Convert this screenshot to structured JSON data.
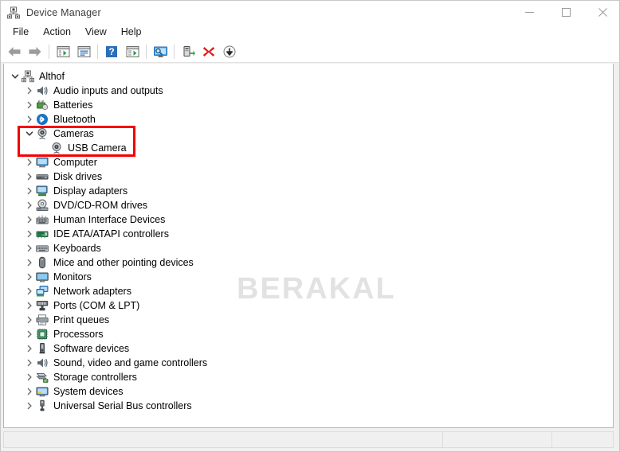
{
  "window": {
    "title": "Device Manager",
    "icon": "device-manager-icon",
    "controls": {
      "minimize": "─",
      "maximize": "□",
      "close": "✕"
    }
  },
  "menubar": {
    "items": [
      {
        "label": "File",
        "name": "menu-file"
      },
      {
        "label": "Action",
        "name": "menu-action"
      },
      {
        "label": "View",
        "name": "menu-view"
      },
      {
        "label": "Help",
        "name": "menu-help"
      }
    ]
  },
  "toolbar": {
    "buttons": [
      {
        "name": "back-button",
        "icon": "back-arrow-icon",
        "tooltip": "Back"
      },
      {
        "name": "forward-button",
        "icon": "forward-arrow-icon",
        "tooltip": "Forward"
      },
      {
        "name": "separator-1",
        "icon": "separator",
        "tooltip": ""
      },
      {
        "name": "show-hide-console-tree-button",
        "icon": "console-tree-icon",
        "tooltip": "Show/Hide Console Tree"
      },
      {
        "name": "properties-button",
        "icon": "properties-icon",
        "tooltip": "Properties"
      },
      {
        "name": "separator-2",
        "icon": "separator",
        "tooltip": ""
      },
      {
        "name": "help-button",
        "icon": "help-question-icon",
        "tooltip": "Help"
      },
      {
        "name": "show-hide-action-pane-button",
        "icon": "action-pane-icon",
        "tooltip": "Show/Hide Action Pane"
      },
      {
        "name": "separator-3",
        "icon": "separator",
        "tooltip": ""
      },
      {
        "name": "scan-for-hardware-changes-button",
        "icon": "monitor-scan-icon",
        "tooltip": "Scan for hardware changes"
      },
      {
        "name": "separator-4",
        "icon": "separator",
        "tooltip": ""
      },
      {
        "name": "update-driver-button",
        "icon": "update-driver-icon",
        "tooltip": "Update Driver Software"
      },
      {
        "name": "uninstall-device-button",
        "icon": "red-x-icon",
        "tooltip": "Uninstall device"
      },
      {
        "name": "disable-device-button",
        "icon": "down-arrow-circle-icon",
        "tooltip": "Disable device"
      }
    ]
  },
  "tree": {
    "nodes": [
      {
        "label": "Althof",
        "depth": 0,
        "expanded": true,
        "twisty": "chevron-down",
        "icon": "computer-root-icon",
        "name": "tree-node-althof"
      },
      {
        "label": "Audio inputs and outputs",
        "depth": 1,
        "expanded": false,
        "twisty": "chevron-right",
        "icon": "speaker-icon",
        "name": "tree-node-audio-inputs-and-outputs"
      },
      {
        "label": "Batteries",
        "depth": 1,
        "expanded": false,
        "twisty": "chevron-right",
        "icon": "battery-icon",
        "name": "tree-node-batteries"
      },
      {
        "label": "Bluetooth",
        "depth": 1,
        "expanded": false,
        "twisty": "chevron-right",
        "icon": "bluetooth-icon",
        "name": "tree-node-bluetooth"
      },
      {
        "label": "Cameras",
        "depth": 1,
        "expanded": true,
        "twisty": "chevron-down",
        "icon": "camera-icon",
        "name": "tree-node-cameras"
      },
      {
        "label": "USB Camera",
        "depth": 2,
        "expanded": false,
        "twisty": "none",
        "icon": "camera-icon",
        "name": "tree-node-usb-camera"
      },
      {
        "label": "Computer",
        "depth": 1,
        "expanded": false,
        "twisty": "chevron-right",
        "icon": "monitor-icon",
        "name": "tree-node-computer"
      },
      {
        "label": "Disk drives",
        "depth": 1,
        "expanded": false,
        "twisty": "chevron-right",
        "icon": "disk-drive-icon",
        "name": "tree-node-disk-drives"
      },
      {
        "label": "Display adapters",
        "depth": 1,
        "expanded": false,
        "twisty": "chevron-right",
        "icon": "display-adapter-icon",
        "name": "tree-node-display-adapters"
      },
      {
        "label": "DVD/CD-ROM drives",
        "depth": 1,
        "expanded": false,
        "twisty": "chevron-right",
        "icon": "optical-drive-icon",
        "name": "tree-node-dvd-cd-rom-drives"
      },
      {
        "label": "Human Interface Devices",
        "depth": 1,
        "expanded": false,
        "twisty": "chevron-right",
        "icon": "hid-icon",
        "name": "tree-node-human-interface-devices"
      },
      {
        "label": "IDE ATA/ATAPI controllers",
        "depth": 1,
        "expanded": false,
        "twisty": "chevron-right",
        "icon": "ide-controller-icon",
        "name": "tree-node-ide-ata-atapi-controllers"
      },
      {
        "label": "Keyboards",
        "depth": 1,
        "expanded": false,
        "twisty": "chevron-right",
        "icon": "keyboard-icon",
        "name": "tree-node-keyboards"
      },
      {
        "label": "Mice and other pointing devices",
        "depth": 1,
        "expanded": false,
        "twisty": "chevron-right",
        "icon": "mouse-icon",
        "name": "tree-node-mice-and-other-pointing-devices"
      },
      {
        "label": "Monitors",
        "depth": 1,
        "expanded": false,
        "twisty": "chevron-right",
        "icon": "monitor-blue-icon",
        "name": "tree-node-monitors"
      },
      {
        "label": "Network adapters",
        "depth": 1,
        "expanded": false,
        "twisty": "chevron-right",
        "icon": "network-adapter-icon",
        "name": "tree-node-network-adapters"
      },
      {
        "label": "Ports (COM & LPT)",
        "depth": 1,
        "expanded": false,
        "twisty": "chevron-right",
        "icon": "port-icon",
        "name": "tree-node-ports-com-lpt"
      },
      {
        "label": "Print queues",
        "depth": 1,
        "expanded": false,
        "twisty": "chevron-right",
        "icon": "printer-icon",
        "name": "tree-node-print-queues"
      },
      {
        "label": "Processors",
        "depth": 1,
        "expanded": false,
        "twisty": "chevron-right",
        "icon": "processor-icon",
        "name": "tree-node-processors"
      },
      {
        "label": "Software devices",
        "depth": 1,
        "expanded": false,
        "twisty": "chevron-right",
        "icon": "software-device-icon",
        "name": "tree-node-software-devices"
      },
      {
        "label": "Sound, video and game controllers",
        "depth": 1,
        "expanded": false,
        "twisty": "chevron-right",
        "icon": "speaker-icon",
        "name": "tree-node-sound-video-and-game-controllers"
      },
      {
        "label": "Storage controllers",
        "depth": 1,
        "expanded": false,
        "twisty": "chevron-right",
        "icon": "storage-controller-icon",
        "name": "tree-node-storage-controllers"
      },
      {
        "label": "System devices",
        "depth": 1,
        "expanded": false,
        "twisty": "chevron-right",
        "icon": "system-device-icon",
        "name": "tree-node-system-devices"
      },
      {
        "label": "Universal Serial Bus controllers",
        "depth": 1,
        "expanded": false,
        "twisty": "chevron-right",
        "icon": "usb-icon",
        "name": "tree-node-universal-serial-bus-controllers"
      }
    ]
  },
  "annotation": {
    "highlight_color": "#f50000",
    "target_nodes": [
      "Cameras",
      "USB Camera"
    ]
  },
  "watermark": {
    "text": "BERAKAL",
    "color": "#e2e2e2"
  },
  "statusbar": {
    "panes": [
      "",
      "",
      ""
    ]
  }
}
